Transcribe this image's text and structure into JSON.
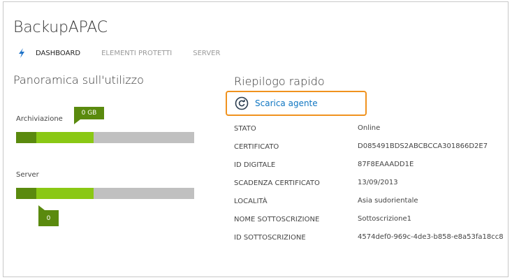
{
  "header": {
    "title": "BackupAPAC"
  },
  "tabs": [
    {
      "label": "DASHBOARD",
      "active": true
    },
    {
      "label": "ELEMENTI PROTETTI",
      "active": false
    },
    {
      "label": "SERVER",
      "active": false
    }
  ],
  "usage": {
    "title": "Panoramica sull'utilizzo",
    "storage": {
      "label": "Archiviazione",
      "value": "0 GB"
    },
    "servers": {
      "label": "Server",
      "value": "0"
    }
  },
  "summary": {
    "title": "Riepilogo rapido",
    "download_label": "Scarica agente",
    "rows": [
      {
        "key": "STATO",
        "value": "Online"
      },
      {
        "key": "CERTIFICATO",
        "value": "D085491BDS2ABCBCCA301866D2E7"
      },
      {
        "key": "ID DIGITALE",
        "value": "87F8EAAADD1E"
      },
      {
        "key": "SCADENZA CERTIFICATO",
        "value": "13/09/2013"
      },
      {
        "key": "LOCALITÀ",
        "value": "Asia sudorientale"
      },
      {
        "key": "NOME SOTTOSCRIZIONE",
        "value": "Sottoscrizione1"
      },
      {
        "key": "ID SOTTOSCRIZIONE",
        "value": "4574def0-969c-4de3-b858-e8a53fa18cc8"
      }
    ]
  },
  "colors": {
    "bar_dark": "#5a8a0e",
    "bar_light": "#8ac814",
    "bar_track": "#c0c0c0",
    "highlight": "#f0921e",
    "link": "#0f76c2"
  },
  "icons": {
    "dashboard": "lightning-bolt-icon",
    "download": "refresh-circle-icon"
  }
}
